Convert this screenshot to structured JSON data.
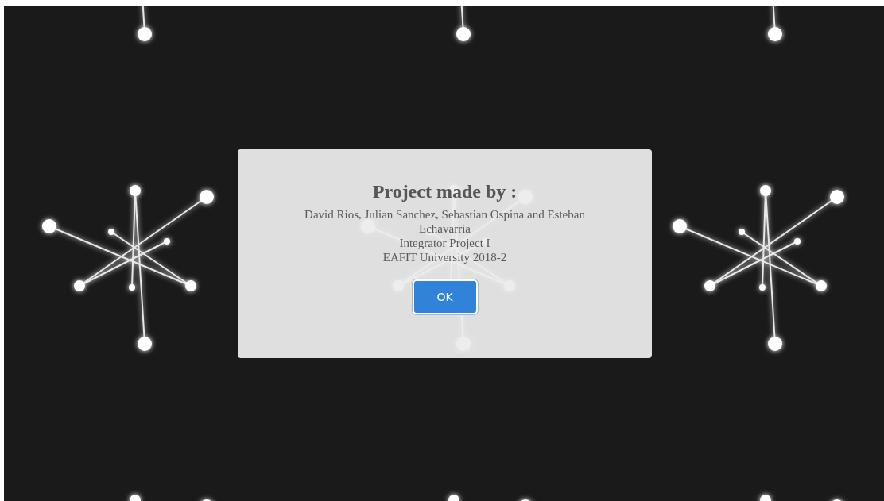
{
  "dialog": {
    "title": "Project made by :",
    "lines": [
      "David Rios, Julian Sanchez, Sebastian Ospina and Esteban Echavarría",
      "Integrator Project I",
      "EAFIT University 2018-2"
    ],
    "button": "OK"
  }
}
